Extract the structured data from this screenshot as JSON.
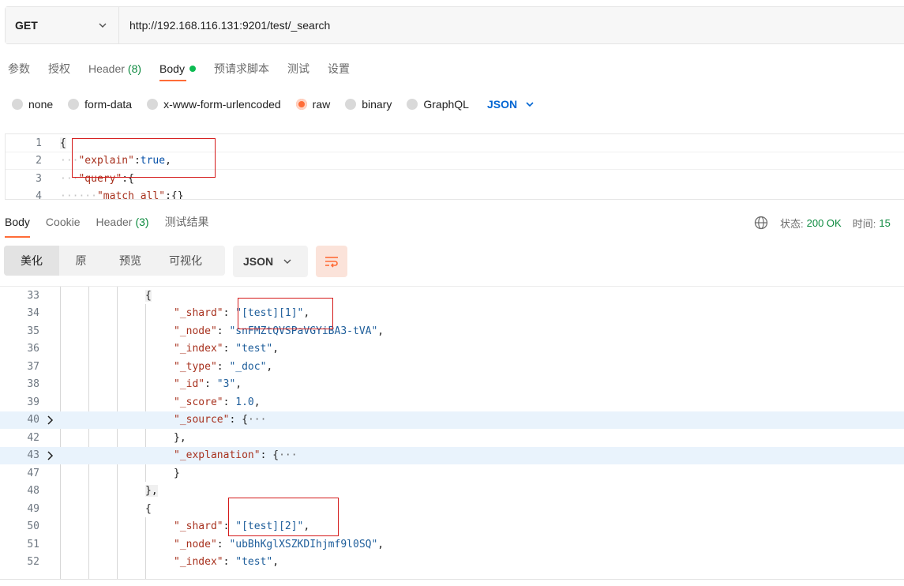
{
  "request": {
    "method": "GET",
    "url": "http://192.168.116.131:9201/test/_search"
  },
  "request_tabs": [
    {
      "label": "参数"
    },
    {
      "label": "授权"
    },
    {
      "label": "Header",
      "count": "(8)"
    },
    {
      "label": "Body"
    },
    {
      "label": "预请求脚本"
    },
    {
      "label": "测试"
    },
    {
      "label": "设置"
    }
  ],
  "body_types": [
    "none",
    "form-data",
    "x-www-form-urlencoded",
    "raw",
    "binary",
    "GraphQL"
  ],
  "body_type_selected": "raw",
  "body_language": "JSON",
  "request_body": {
    "lines": [
      {
        "num": "1",
        "text": "{"
      },
      {
        "num": "2",
        "key": "\"explain\"",
        "sep": ":",
        "val": "true",
        "end": ","
      },
      {
        "num": "3",
        "key": "\"query\"",
        "sep": ":",
        "val": "{",
        "end": ""
      },
      {
        "num": "4",
        "key": "\"match_all\"",
        "sep": ":",
        "val": "{}",
        "end": ""
      }
    ]
  },
  "response_tabs": [
    {
      "label": "Body"
    },
    {
      "label": "Cookie"
    },
    {
      "label": "Header",
      "count": "(3)"
    },
    {
      "label": "测试结果"
    }
  ],
  "status": {
    "status_label": "状态:",
    "status_value": "200 OK",
    "time_label": "时间:",
    "time_value": "15"
  },
  "view_modes": [
    "美化",
    "原",
    "预览",
    "可视化"
  ],
  "response_format": "JSON",
  "response_lines": [
    {
      "num": "33",
      "indent": 0,
      "text": "{"
    },
    {
      "num": "34",
      "indent": 1,
      "key": "\"_shard\"",
      "val": "\"[test][1]\"",
      "end": ","
    },
    {
      "num": "35",
      "indent": 1,
      "key": "\"_node\"",
      "val": "\"snFMZtQVSPaVGYiBA3-tVA\"",
      "end": ","
    },
    {
      "num": "36",
      "indent": 1,
      "key": "\"_index\"",
      "val": "\"test\"",
      "end": ","
    },
    {
      "num": "37",
      "indent": 1,
      "key": "\"_type\"",
      "val": "\"_doc\"",
      "end": ","
    },
    {
      "num": "38",
      "indent": 1,
      "key": "\"_id\"",
      "val": "\"3\"",
      "end": ","
    },
    {
      "num": "39",
      "indent": 1,
      "key": "\"_score\"",
      "val": "1.0",
      "end": ","
    },
    {
      "num": "40",
      "indent": 1,
      "key": "\"_source\"",
      "val": "{",
      "fold": true,
      "dots": "···"
    },
    {
      "num": "42",
      "indent": 1,
      "text": "},"
    },
    {
      "num": "43",
      "indent": 1,
      "key": "\"_explanation\"",
      "val": "{",
      "fold": true,
      "dots": "···"
    },
    {
      "num": "47",
      "indent": 1,
      "text": "}"
    },
    {
      "num": "48",
      "indent": 0,
      "text": "},"
    },
    {
      "num": "49",
      "indent": 0,
      "text": "{"
    },
    {
      "num": "50",
      "indent": 1,
      "key": "\"_shard\"",
      "val": "\"[test][2]\"",
      "end": ","
    },
    {
      "num": "51",
      "indent": 1,
      "key": "\"_node\"",
      "val": "\"ubBhKglXSZKDIhjmf9l0SQ\"",
      "end": ","
    },
    {
      "num": "52",
      "indent": 1,
      "key": "\"_index\"",
      "val": "\"test\"",
      "end": ","
    }
  ],
  "colors": {
    "accent": "#ff6c37",
    "key": "#a7311e",
    "string": "#1d5d9a",
    "status_ok": "#0d8a3f",
    "annotation_box": "#d41a1a"
  }
}
